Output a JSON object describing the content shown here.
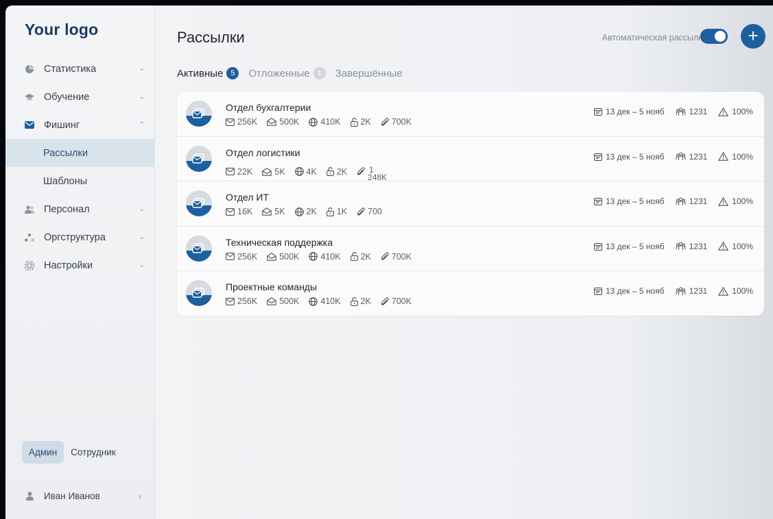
{
  "brand": {
    "logo_text": "Your logo",
    "accent": "#1e5fa0"
  },
  "sidebar": {
    "items": [
      {
        "label": "Статистика",
        "icon": "pie-chart-icon",
        "expanded": false
      },
      {
        "label": "Обучение",
        "icon": "graduation-cap-icon",
        "expanded": false
      },
      {
        "label": "Фишинг",
        "icon": "mail-icon",
        "expanded": true
      },
      {
        "label": "Рассылки",
        "sub": true,
        "active": true
      },
      {
        "label": "Шаблоны",
        "sub": true
      },
      {
        "label": "Персонал",
        "icon": "users-icon",
        "expanded": false
      },
      {
        "label": "Оргструктура",
        "icon": "org-structure-icon",
        "expanded": false
      },
      {
        "label": "Настройки",
        "icon": "gear-icon",
        "expanded": false
      }
    ],
    "roles": {
      "admin": "Админ",
      "employee": "Сотрудник",
      "selected": "admin"
    },
    "user": {
      "name": "Иван Иванов"
    }
  },
  "header": {
    "title": "Рассылки",
    "auto_label": "Автоматическая рассылка",
    "auto_enabled": true
  },
  "tabs": [
    {
      "label": "Активные",
      "count": "5"
    },
    {
      "label": "Отложенные",
      "count": "1"
    },
    {
      "label": "Завершённые",
      "count": ""
    }
  ],
  "mailings": [
    {
      "title": "Отдел бухгалтерии",
      "sent": "256K",
      "opened": "500K",
      "visited": "410K",
      "entered": "2K",
      "attachments": "700K",
      "period": "13 дек – 5 нояб",
      "employees": "1231",
      "risk": "100%"
    },
    {
      "title": "Отдел логистики",
      "sent": "22K",
      "opened": "5K",
      "visited": "4K",
      "entered": "2K",
      "attachments_top": "1",
      "attachments_bottom": "248K",
      "period": "13 дек – 5 нояб",
      "employees": "1231",
      "risk": "100%"
    },
    {
      "title": "Отдел ИТ",
      "sent": "16K",
      "opened": "5K",
      "visited": "2K",
      "entered": "1K",
      "attachments": "700",
      "period": "13 дек – 5 нояб",
      "employees": "1231",
      "risk": "100%"
    },
    {
      "title": "Техническая поддержка",
      "sent": "256K",
      "opened": "500K",
      "visited": "410K",
      "entered": "2K",
      "attachments": "700K",
      "period": "13 дек – 5 нояб",
      "employees": "1231",
      "risk": "100%"
    },
    {
      "title": "Проектные команды",
      "sent": "256K",
      "opened": "500K",
      "visited": "410K",
      "entered": "2K",
      "attachments": "700K",
      "period": "13 дек – 5 нояб",
      "employees": "1231",
      "risk": "100%"
    }
  ]
}
